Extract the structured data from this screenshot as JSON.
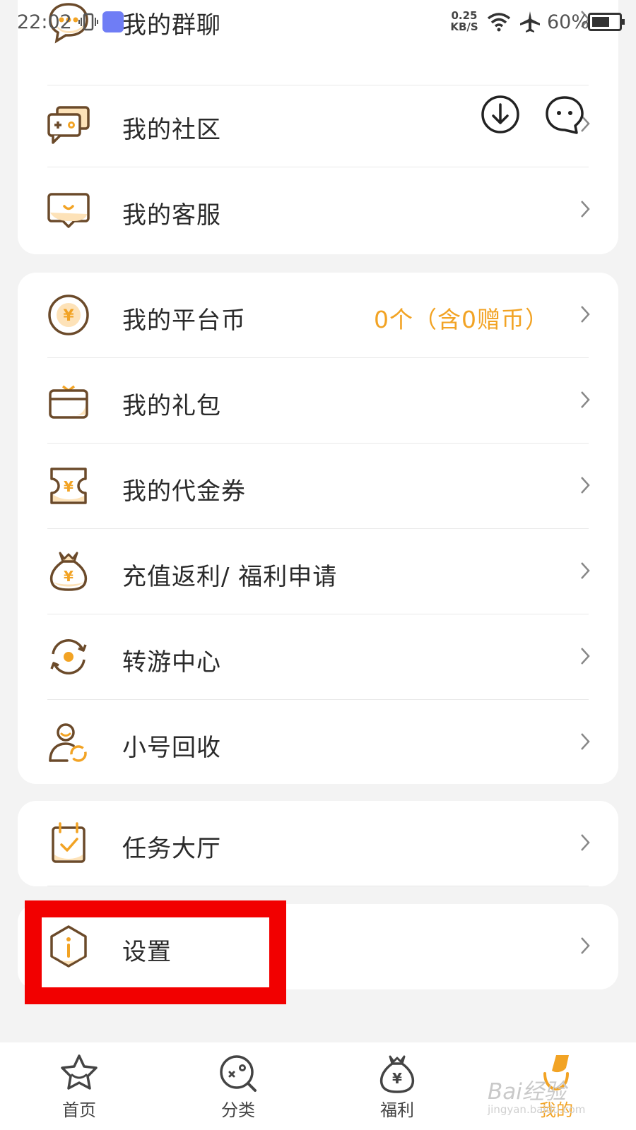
{
  "status_bar": {
    "time": "22:02",
    "net_speed_value": "0.25",
    "net_speed_unit": "KB/S",
    "battery": "60%"
  },
  "group1": [
    {
      "label": "我的群聊",
      "icon": "chat-bubble-icon"
    },
    {
      "label": "我的社区",
      "icon": "community-icon"
    },
    {
      "label": "我的客服",
      "icon": "customer-service-icon"
    }
  ],
  "group2": [
    {
      "label": "我的平台币",
      "icon": "yuan-coin-icon",
      "value": "0个（含0赠币）"
    },
    {
      "label": "我的礼包",
      "icon": "gift-pack-icon"
    },
    {
      "label": "我的代金券",
      "icon": "voucher-icon"
    },
    {
      "label": "充值返利/ 福利申请",
      "icon": "money-bag-icon"
    },
    {
      "label": "转游中心",
      "icon": "transfer-icon"
    },
    {
      "label": "小号回收",
      "icon": "account-recycle-icon"
    }
  ],
  "group3": [
    {
      "label": "任务大厅",
      "icon": "task-clipboard-icon"
    }
  ],
  "group4": [
    {
      "label": "设置",
      "icon": "settings-info-icon"
    }
  ],
  "bottom_nav": [
    {
      "label": "首页",
      "icon": "star-home-icon"
    },
    {
      "label": "分类",
      "icon": "category-icon"
    },
    {
      "label": "福利",
      "icon": "welfare-bag-icon"
    },
    {
      "label": "我的",
      "icon": "mine-icon",
      "active": true
    }
  ],
  "watermark": {
    "text": "Bai经验",
    "sub": "jingyan.baidu.com"
  },
  "colors": {
    "accent": "#f2a324",
    "icon_brown": "#6b4a2a",
    "highlight": "#f20000"
  }
}
